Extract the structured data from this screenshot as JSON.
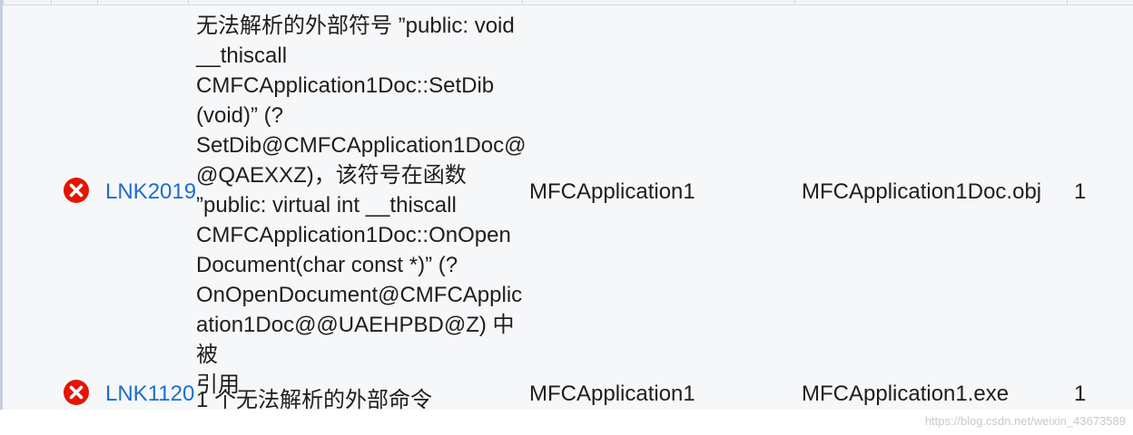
{
  "errors": [
    {
      "code": "LNK2019",
      "description": "无法解析的外部符号 ”public: void __thiscall CMFCApplication1Doc::SetDib(void)” (?SetDib@CMFCApplication1Doc@@QAEXXZ)，该符号在函数 ”public: virtual int __thiscall CMFCApplication1Doc::OnOpenDocument(char const *)” (?OnOpenDocument@CMFCApplication1Doc@@UAEHPBD@Z) 中被引用",
      "description_lines": [
        "无法解析的外部符号 ”public: void",
        "__thiscall",
        "CMFCApplication1Doc::SetDib",
        "(void)” (?",
        "SetDib@CMFCApplication1Doc@",
        "@QAEXXZ)，该符号在函数",
        "”public: virtual int __thiscall",
        "CMFCApplication1Doc::OnOpen",
        "Document(char const *)” (?",
        "OnOpenDocument@CMFCApplic",
        "ation1Doc@@UAEHPBD@Z) 中被",
        "引用"
      ],
      "project": "MFCApplication1",
      "file": "MFCApplication1Doc.obj",
      "line": "1",
      "icon": "error-circle-x-icon"
    },
    {
      "code": "LNK1120",
      "description": "1 个无法解析的外部命令",
      "project": "MFCApplication1",
      "file": "MFCApplication1.exe",
      "line": "1",
      "icon": "error-circle-x-icon"
    }
  ],
  "watermark": "https://blog.csdn.net/weixin_43673589",
  "colors": {
    "error_red": "#e51400",
    "link_blue": "#1a6fd0",
    "row_bg": "#f6f7f9"
  }
}
